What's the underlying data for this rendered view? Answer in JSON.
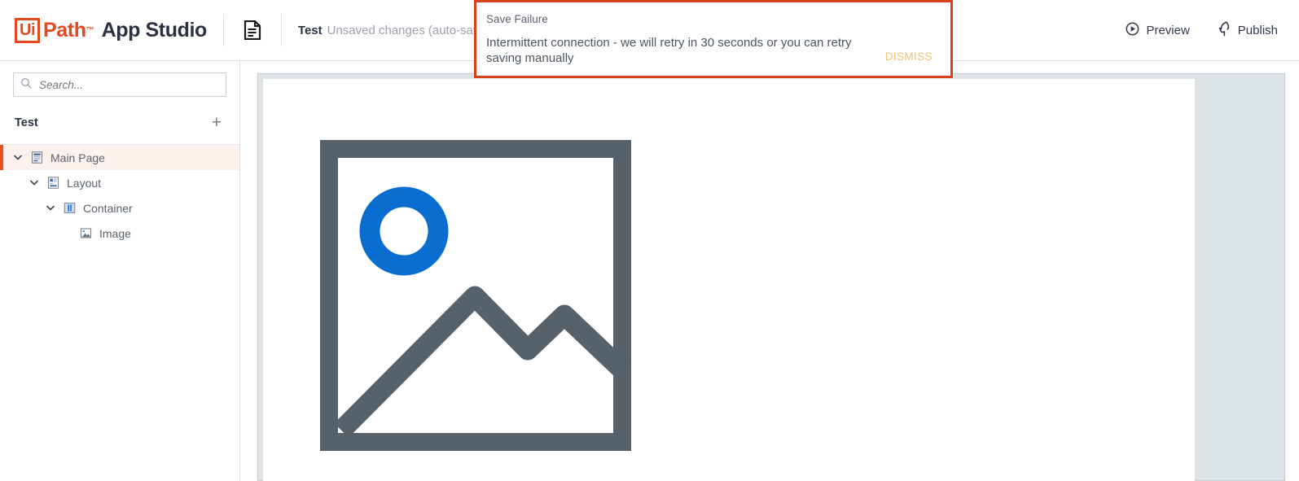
{
  "header": {
    "logo": {
      "ui": "Ui",
      "path": "Path",
      "tm": "™",
      "product": "App Studio"
    },
    "doc_icon": "document-icon",
    "app_title": "Test",
    "app_status": "Unsaved changes (auto-save happen",
    "actions": [
      {
        "icon": "play-circle-icon",
        "label": "Preview"
      },
      {
        "icon": "publish-bolt-icon",
        "label": "Publish"
      }
    ]
  },
  "notification": {
    "title": "Save Failure",
    "message": "Intermittent connection - we will retry in 30 seconds or you can retry saving manually",
    "dismiss_label": "DISMISS",
    "border_color": "#d6411a",
    "dismiss_color": "#f3c27a"
  },
  "sidebar": {
    "search": {
      "icon": "search-icon",
      "placeholder": "Search...",
      "value": ""
    },
    "project": {
      "name": "Test",
      "add_label": "+"
    },
    "tree": [
      {
        "label": "Main Page",
        "icon": "page-icon",
        "depth": 0,
        "expanded": true,
        "selected": true
      },
      {
        "label": "Layout",
        "icon": "layout-icon",
        "depth": 1,
        "expanded": true,
        "selected": false
      },
      {
        "label": "Container",
        "icon": "container-icon",
        "depth": 2,
        "expanded": true,
        "selected": false
      },
      {
        "label": "Image",
        "icon": "image-icon",
        "depth": 3,
        "expanded": null,
        "selected": false
      }
    ]
  },
  "canvas": {
    "background_color": "#dde4e8",
    "page_color": "#ffffff",
    "element": {
      "name": "image-placeholder",
      "frame_color": "#55626b",
      "accent_color": "#0a6ed1"
    }
  },
  "colors": {
    "brand_orange": "#e4481f",
    "selection_bg": "#fdf1ee",
    "text_dark": "#2c3142",
    "text_muted": "#9aa0ab"
  }
}
